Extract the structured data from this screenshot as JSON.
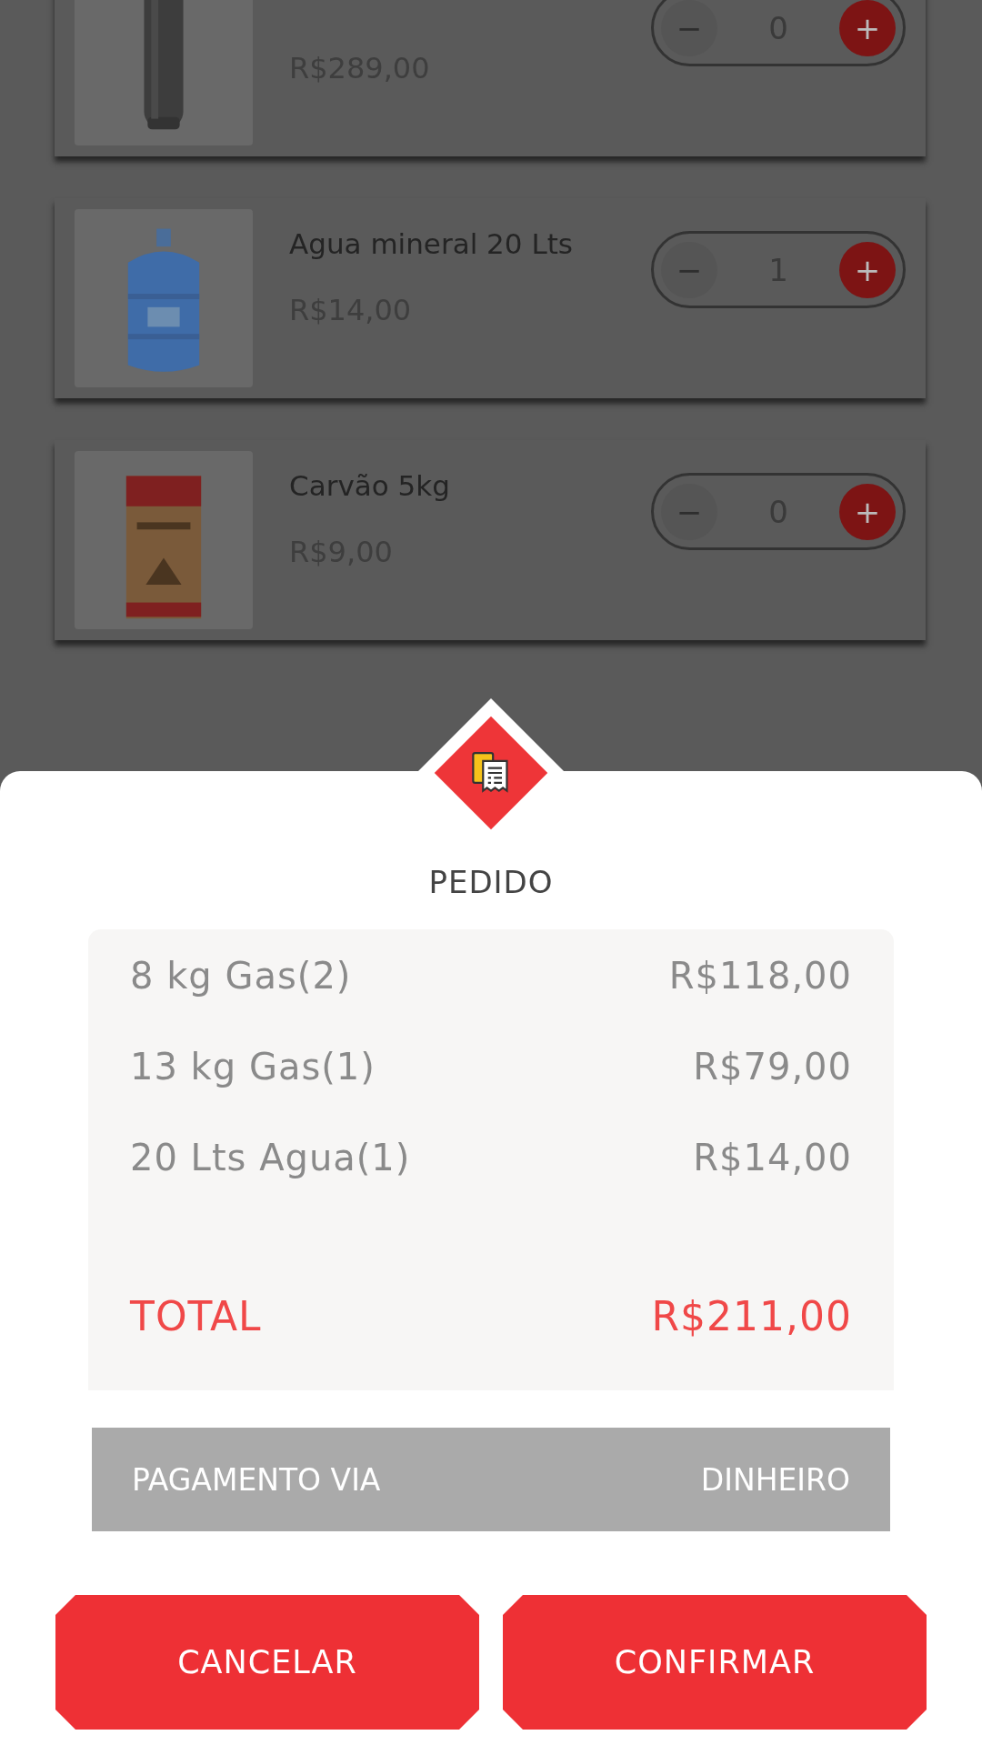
{
  "products": [
    {
      "price": "R$289,00",
      "quantity": "0",
      "minus": "−",
      "plus": "+"
    },
    {
      "title": "Agua mineral 20 Lts",
      "price": "R$14,00",
      "quantity": "1",
      "minus": "−",
      "plus": "+"
    },
    {
      "title": "Carvão 5kg",
      "price": "R$9,00",
      "quantity": "0",
      "minus": "−",
      "plus": "+"
    }
  ],
  "order": {
    "title": "PEDIDO",
    "items": [
      {
        "name": "8 kg Gas(2)",
        "price": "R$118,00"
      },
      {
        "name": "13 kg Gas(1)",
        "price": "R$79,00"
      },
      {
        "name": "20 Lts Agua(1)",
        "price": "R$14,00"
      }
    ],
    "total": {
      "label": "TOTAL",
      "value": "R$211,00"
    },
    "payment": {
      "label": "PAGAMENTO VIA",
      "method": "DINHEIRO"
    },
    "buttons": [
      "CANCELAR",
      "CONFIRMAR"
    ]
  }
}
